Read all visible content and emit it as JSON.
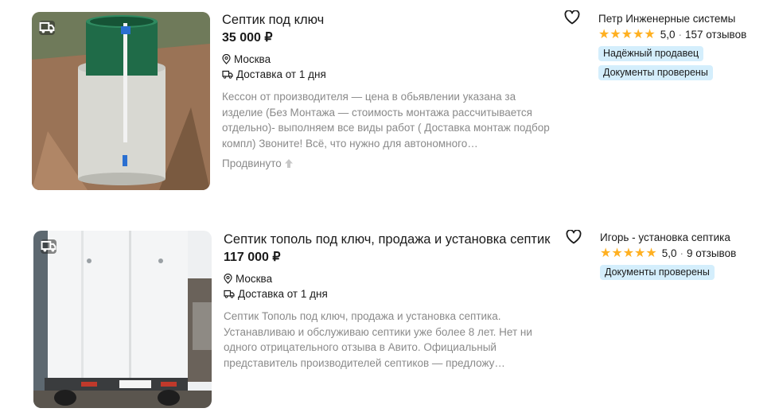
{
  "listings": [
    {
      "title": "Септик под ключ",
      "price": "35 000 ₽",
      "location": "Москва",
      "delivery": "Доставка от 1 дня",
      "description": "Кессон от производителя — цена в обьявлении указана за изделие (Без Монтажа — стоимость монтажа рассчитывается отдельно)- выполняем все виды работ ( Доставка монтаж подбор компл) Звоните! Всё, что нужно для автономного…",
      "promo": "Продвинуто",
      "seller": {
        "name": "Петр Инженерные системы",
        "rating": "5,0",
        "reviews": "157 отзывов",
        "tags": [
          "Надёжный продавец",
          "Документы проверены"
        ]
      }
    },
    {
      "title": "Септик тополь под ключ, продажа и установка септик",
      "price": "117 000 ₽",
      "location": "Москва",
      "delivery": "Доставка от 1 дня",
      "description": "Септик Тополь под ключ, продажа и установка септика. Устанавливаю и обслуживаю септики уже более 8 лет. Нет ни одного отрицательного отзыва в Авито. Официальный представитель производителей септиков — предложу…",
      "seller": {
        "name": "Игорь - установка септика",
        "rating": "5,0",
        "reviews": "9 отзывов",
        "tags": [
          "Документы проверены"
        ]
      }
    }
  ],
  "colors": {
    "star": "#ffb021",
    "tag_bg": "#d4eefc",
    "muted_text": "#8a8a8a"
  },
  "icons": [
    "truck-icon",
    "location-pin-icon",
    "delivery-truck-icon",
    "heart-icon",
    "star-icon",
    "arrow-up-icon"
  ]
}
